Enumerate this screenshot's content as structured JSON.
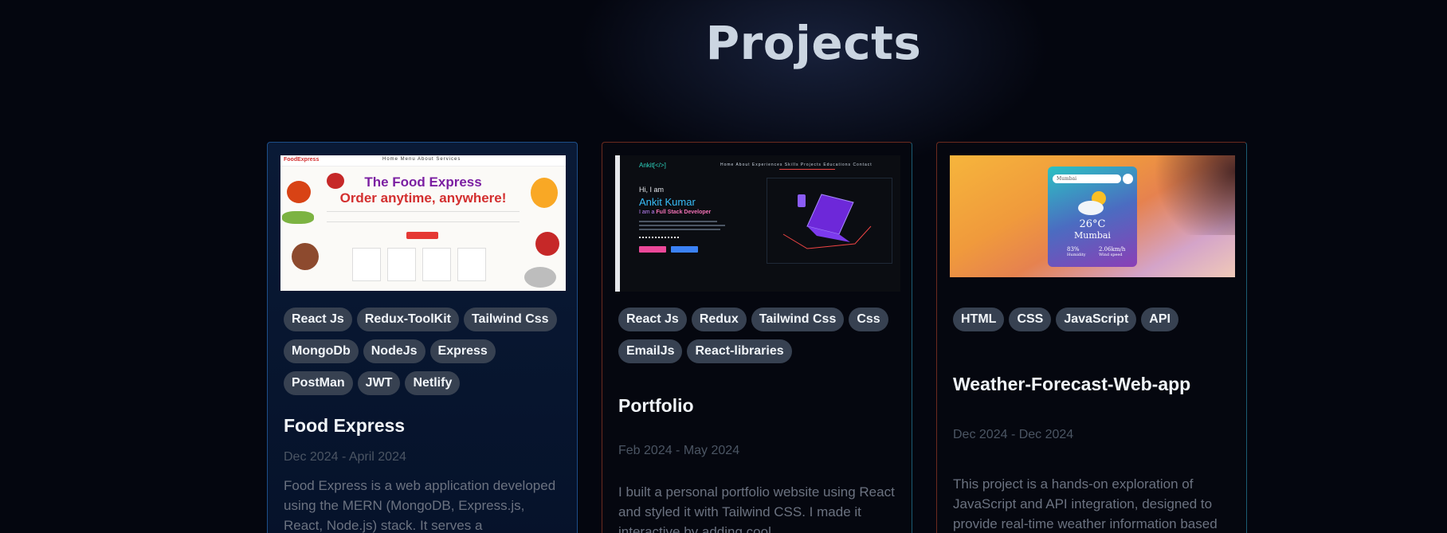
{
  "page": {
    "heading": "Projects"
  },
  "projects": [
    {
      "title": "Food Express",
      "date": "Dec 2024 - April 2024",
      "description": "Food Express is a web application developed using the MERN (MongoDB, Express.js, React, Node.js) stack. It serves a",
      "tags": [
        "React Js",
        "Redux-ToolKit",
        "Tailwind Css",
        "MongoDb",
        "NodeJs",
        "Express",
        "PostMan",
        "JWT",
        "Netlify"
      ],
      "thumbnail": {
        "logo": "FoodExpress",
        "nav": "Home  Menu  About  Services",
        "headline1": "The Food Express",
        "headline2": "Order anytime, anywhere!"
      }
    },
    {
      "title": "Portfolio",
      "date": "Feb 2024 - May 2024",
      "description": "I built a personal portfolio website using React and styled it with Tailwind CSS. I made it interactive by adding cool",
      "tags": [
        "React Js",
        "Redux",
        "Tailwind Css",
        "Css",
        "EmailJs",
        "React-libraries"
      ],
      "thumbnail": {
        "brand": "Ankit[</>]",
        "nav": "Home  About  Experiences  Skills  Projects  Educations  Contact",
        "greeting": "Hi, I am",
        "name": "Ankit Kumar",
        "role_prefix": "I am a ",
        "role": "Full Stack Developer"
      }
    },
    {
      "title": "Weather-Forecast-Web-app",
      "date": "Dec 2024 - Dec 2024",
      "description": "This project is a hands-on exploration of JavaScript and API integration, designed to provide real-time weather information based",
      "tags": [
        "HTML",
        "CSS",
        "JavaScript",
        "API"
      ],
      "thumbnail": {
        "search": "Mumbai",
        "temperature": "26°C",
        "city": "Mumbai",
        "humidity": "83%",
        "humidity_label": "Humidity",
        "wind": "2.06km/h",
        "wind_label": "Wind speed"
      }
    }
  ]
}
